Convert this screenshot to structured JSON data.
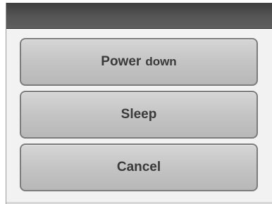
{
  "dialog": {
    "buttons": {
      "power_down": {
        "word1": "Power",
        "word2": "down"
      },
      "sleep_label": "Sleep",
      "cancel_label": "Cancel"
    }
  }
}
